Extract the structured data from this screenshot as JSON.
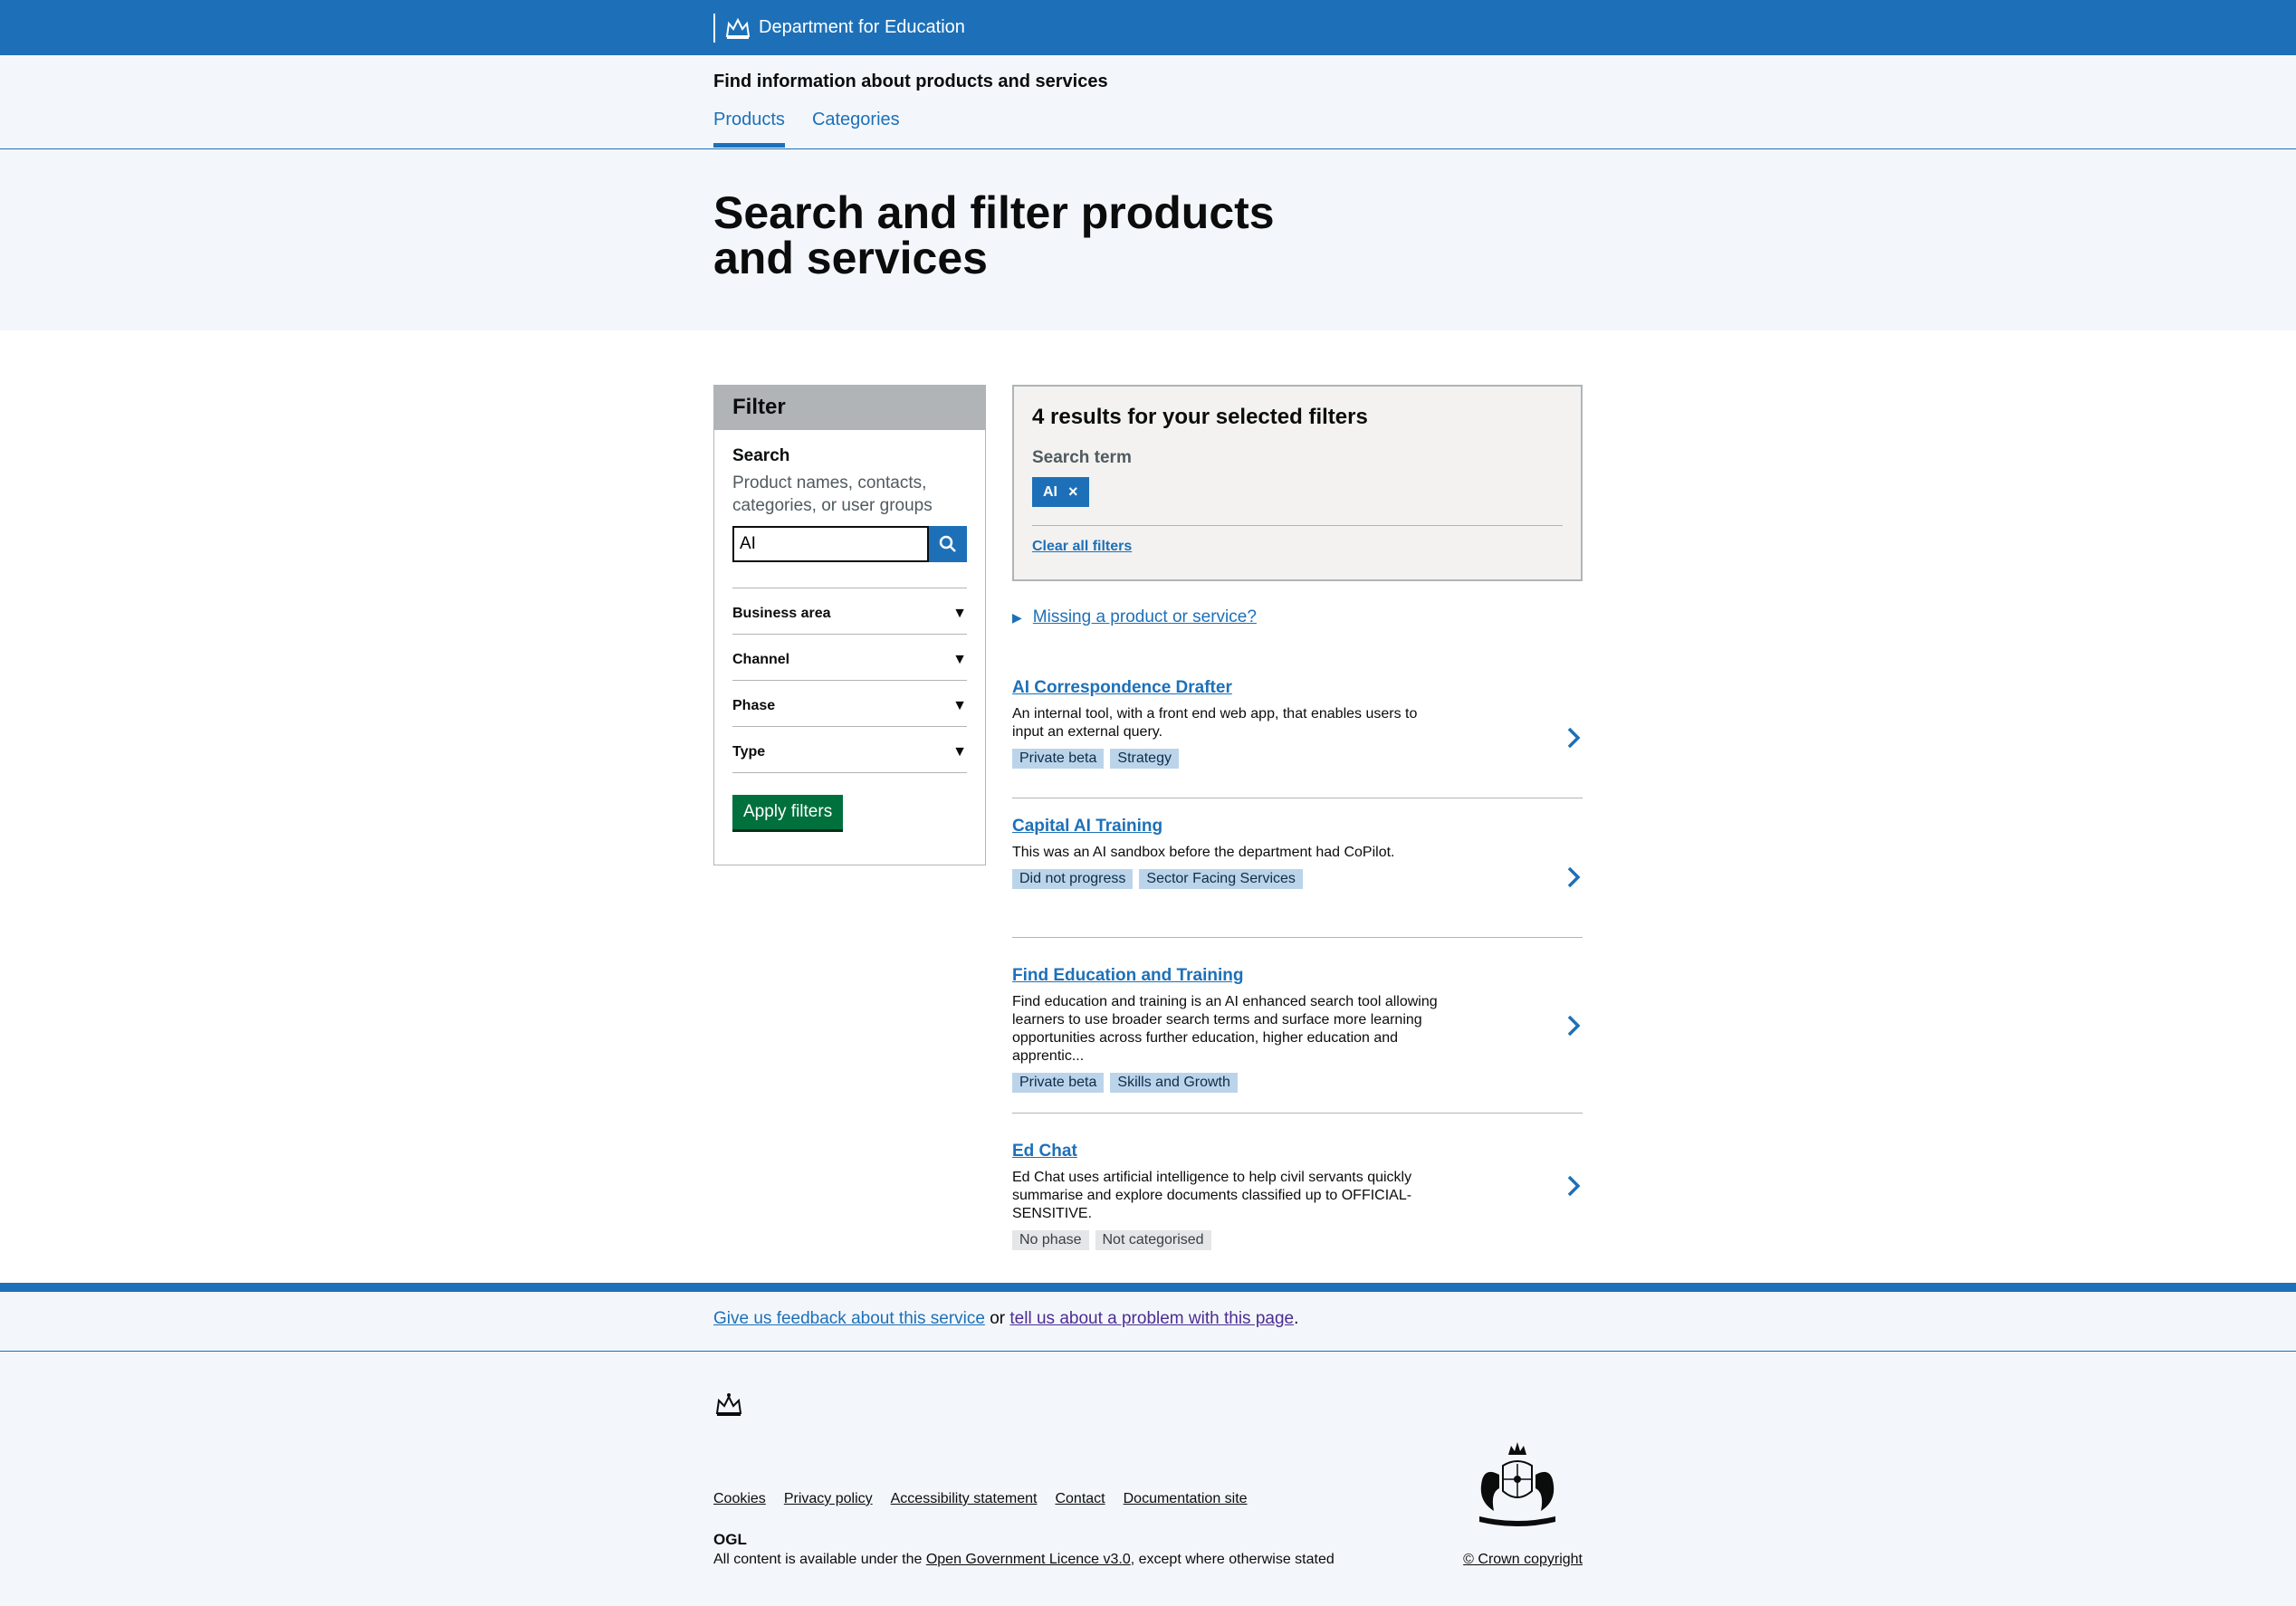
{
  "header": {
    "org_name": "Department for Education",
    "service_name": "Find information about products and services",
    "nav": [
      {
        "label": "Products",
        "active": true
      },
      {
        "label": "Categories",
        "active": false
      }
    ]
  },
  "page": {
    "title": "Search and filter products and services"
  },
  "filter": {
    "heading": "Filter",
    "search_label": "Search",
    "search_hint": "Product names, contacts, categories, or user groups",
    "search_value": "AI",
    "sections": [
      "Business area",
      "Channel",
      "Phase",
      "Type"
    ],
    "apply_label": "Apply filters"
  },
  "results": {
    "summary": "4 results for your selected filters",
    "term_label": "Search term",
    "term_value": "AI",
    "clear_label": "Clear all filters",
    "missing_label": "Missing a product or service?"
  },
  "products": [
    {
      "name": "AI Correspondence Drafter",
      "description": "An internal tool, with a front end web app, that enables users to input an external query.",
      "tags": [
        {
          "label": "Private beta",
          "style": "blue"
        },
        {
          "label": "Strategy",
          "style": "blue"
        }
      ]
    },
    {
      "name": "Capital AI Training",
      "description": "This was an AI sandbox before the department had CoPilot.",
      "tags": [
        {
          "label": "Did not progress",
          "style": "blue"
        },
        {
          "label": "Sector Facing Services",
          "style": "blue"
        }
      ]
    },
    {
      "name": "Find Education and Training",
      "description": "Find education and training is an AI enhanced search tool allowing learners to use broader search terms and surface more learning opportunities across further education, higher education and apprentic...",
      "tags": [
        {
          "label": "Private beta",
          "style": "blue"
        },
        {
          "label": "Skills and Growth",
          "style": "blue"
        }
      ]
    },
    {
      "name": "Ed Chat",
      "description": "Ed Chat uses artificial intelligence to help civil servants quickly summarise and explore documents classified up to OFFICIAL-SENSITIVE.",
      "tags": [
        {
          "label": "No phase",
          "style": "grey"
        },
        {
          "label": "Not categorised",
          "style": "grey"
        }
      ]
    }
  ],
  "footer": {
    "feedback_link": "Give us feedback about this service",
    "feedback_or": "or",
    "problem_link": "tell us about a problem with this page",
    "feedback_end": ".",
    "links": [
      "Cookies",
      "Privacy policy",
      "Accessibility statement",
      "Contact",
      "Documentation site"
    ],
    "ogl_label": "OGL",
    "licence_prefix": "All content is available under the",
    "licence_link": "Open Government Licence v3.0",
    "licence_suffix": ", except where otherwise stated",
    "copyright": "© Crown copyright"
  },
  "colors": {
    "brand_blue": "#1d70b8",
    "apply_green": "#00703c",
    "light_bg": "#f3f7fb"
  }
}
